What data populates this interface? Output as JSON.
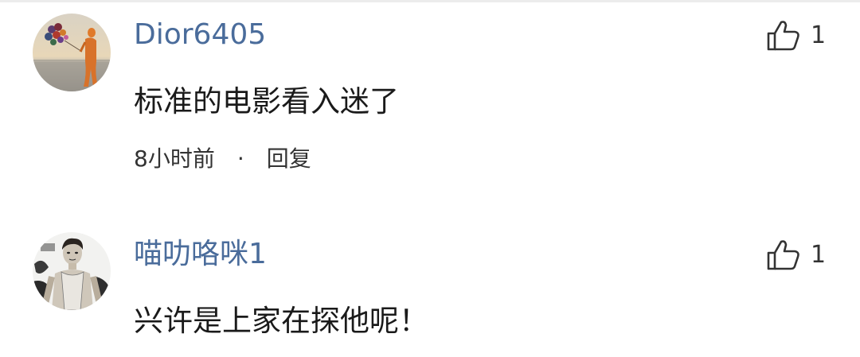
{
  "comments": [
    {
      "username": "Dior6405",
      "content": "标准的电影看入迷了",
      "time": "8小时前",
      "separator": "·",
      "reply_label": "回复",
      "likes": "1",
      "avatar_icon": "sunset-beach-balloons-avatar"
    },
    {
      "username": "喵叻咯咪1",
      "content": "兴许是上家在探他呢！",
      "likes": "1",
      "avatar_icon": "sketch-portrait-avatar"
    }
  ],
  "colors": {
    "username": "#4a6c9b",
    "content": "#1a1a1a",
    "meta": "#333333",
    "background": "#ffffff"
  }
}
